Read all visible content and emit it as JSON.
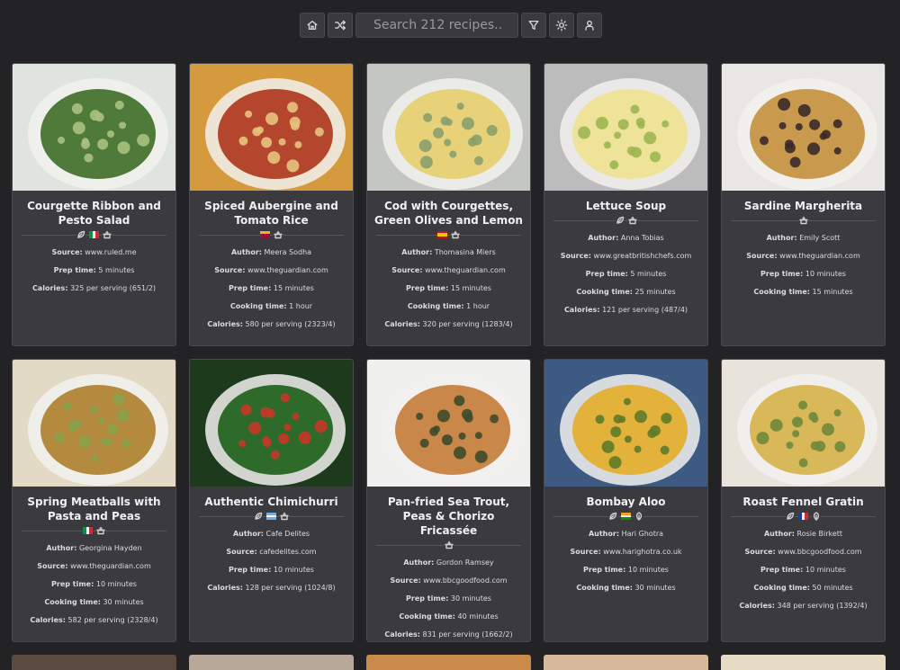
{
  "toolbar": {
    "home_icon": "home-icon",
    "shuffle_icon": "shuffle-icon",
    "search_placeholder": "Search 212 recipes..",
    "filter_icon": "filter-icon",
    "theme_icon": "sun-icon",
    "user_icon": "user-icon"
  },
  "labels": {
    "author": "Author:",
    "source": "Source:",
    "prep": "Prep time:",
    "cooking": "Cooking time:",
    "calories": "Calories:"
  },
  "recipes": [
    {
      "title": "Courgette Ribbon and Pesto Salad",
      "tags": [
        "vegetarian",
        "flag-it",
        "pot"
      ],
      "author": "",
      "source": "www.ruled.me",
      "prep": "5 minutes",
      "cooking": "",
      "calories": "325 per serving (651/2)",
      "photo_colors": [
        "#dfe4df",
        "#4f7a3a",
        "#a8c280"
      ]
    },
    {
      "title": "Spiced Aubergine and Tomato Rice",
      "tags": [
        "flag-lk",
        "pot"
      ],
      "author": "Meera Sodha",
      "source": "www.theguardian.com",
      "prep": "15 minutes",
      "cooking": "1 hour",
      "calories": "580 per serving (2323/4)",
      "photo_colors": [
        "#d59a3e",
        "#b4462e",
        "#e7c27c"
      ]
    },
    {
      "title": "Cod with Courgettes, Green Olives and Lemon",
      "tags": [
        "flag-es",
        "pot"
      ],
      "author": "Thomasina Miers",
      "source": "www.theguardian.com",
      "prep": "15 minutes",
      "cooking": "1 hour",
      "calories": "320 per serving (1283/4)",
      "photo_colors": [
        "#c4c6c2",
        "#e7d27a",
        "#8a9e6a"
      ]
    },
    {
      "title": "Lettuce Soup",
      "tags": [
        "vegetarian",
        "pot"
      ],
      "author": "Anna Tobias",
      "source": "www.greatbritishchefs.com",
      "prep": "5 minutes",
      "cooking": "25 minutes",
      "calories": "121 per serving (487/4)",
      "photo_colors": [
        "#bcbcbc",
        "#efe39a",
        "#9cb650"
      ]
    },
    {
      "title": "Sardine Margherita",
      "tags": [
        "pot"
      ],
      "author": "Emily Scott",
      "source": "www.theguardian.com",
      "prep": "10 minutes",
      "cooking": "15 minutes",
      "calories": "",
      "photo_colors": [
        "#e9e7e3",
        "#c99a4e",
        "#3a2a2a"
      ]
    },
    {
      "title": "Spring Meatballs with Pasta and Peas",
      "tags": [
        "flag-it",
        "pot"
      ],
      "author": "Georgina Hayden",
      "source": "www.theguardian.com",
      "prep": "10 minutes",
      "cooking": "30 minutes",
      "calories": "582 per serving (2328/4)",
      "photo_colors": [
        "#e3dac5",
        "#b48a3e",
        "#8aa04a"
      ]
    },
    {
      "title": "Authentic Chimichurri",
      "tags": [
        "vegetarian",
        "flag-ar",
        "pot"
      ],
      "author": "Cafe Delites",
      "source": "cafedelites.com",
      "prep": "10 minutes",
      "cooking": "",
      "calories": "128 per serving (1024/8)",
      "photo_colors": [
        "#1e3a1c",
        "#2e6a2a",
        "#c43828"
      ]
    },
    {
      "title": "Pan-fried Sea Trout, Peas & Chorizo Fricassée",
      "tags": [
        "pot"
      ],
      "author": "Gordon Ramsey",
      "source": "www.bbcgoodfood.com",
      "prep": "30 minutes",
      "cooking": "40 minutes",
      "calories": "831 per serving (1662/2)",
      "photo_colors": [
        "#f0f0ee",
        "#c9874a",
        "#3e4a2a"
      ]
    },
    {
      "title": "Bombay Aloo",
      "tags": [
        "vegetarian",
        "flag-in",
        "vegan"
      ],
      "author": "Hari Ghotra",
      "source": "www.harighotra.co.uk",
      "prep": "10 minutes",
      "cooking": "30 minutes",
      "calories": "",
      "photo_colors": [
        "#3c5a82",
        "#e2b23a",
        "#5e7a2a"
      ]
    },
    {
      "title": "Roast Fennel Gratin",
      "tags": [
        "vegetarian",
        "flag-fr",
        "vegan"
      ],
      "author": "Rosie Birkett",
      "source": "www.bbcgoodfood.com",
      "prep": "10 minutes",
      "cooking": "50 minutes",
      "calories": "348 per serving (1392/4)",
      "photo_colors": [
        "#e8e4dc",
        "#d9b85a",
        "#6e8a3a"
      ]
    }
  ],
  "bottom_row_colors": [
    "#5a4a40",
    "#b8a89a",
    "#c98a4a",
    "#d6b89a",
    "#e6dcc6"
  ]
}
